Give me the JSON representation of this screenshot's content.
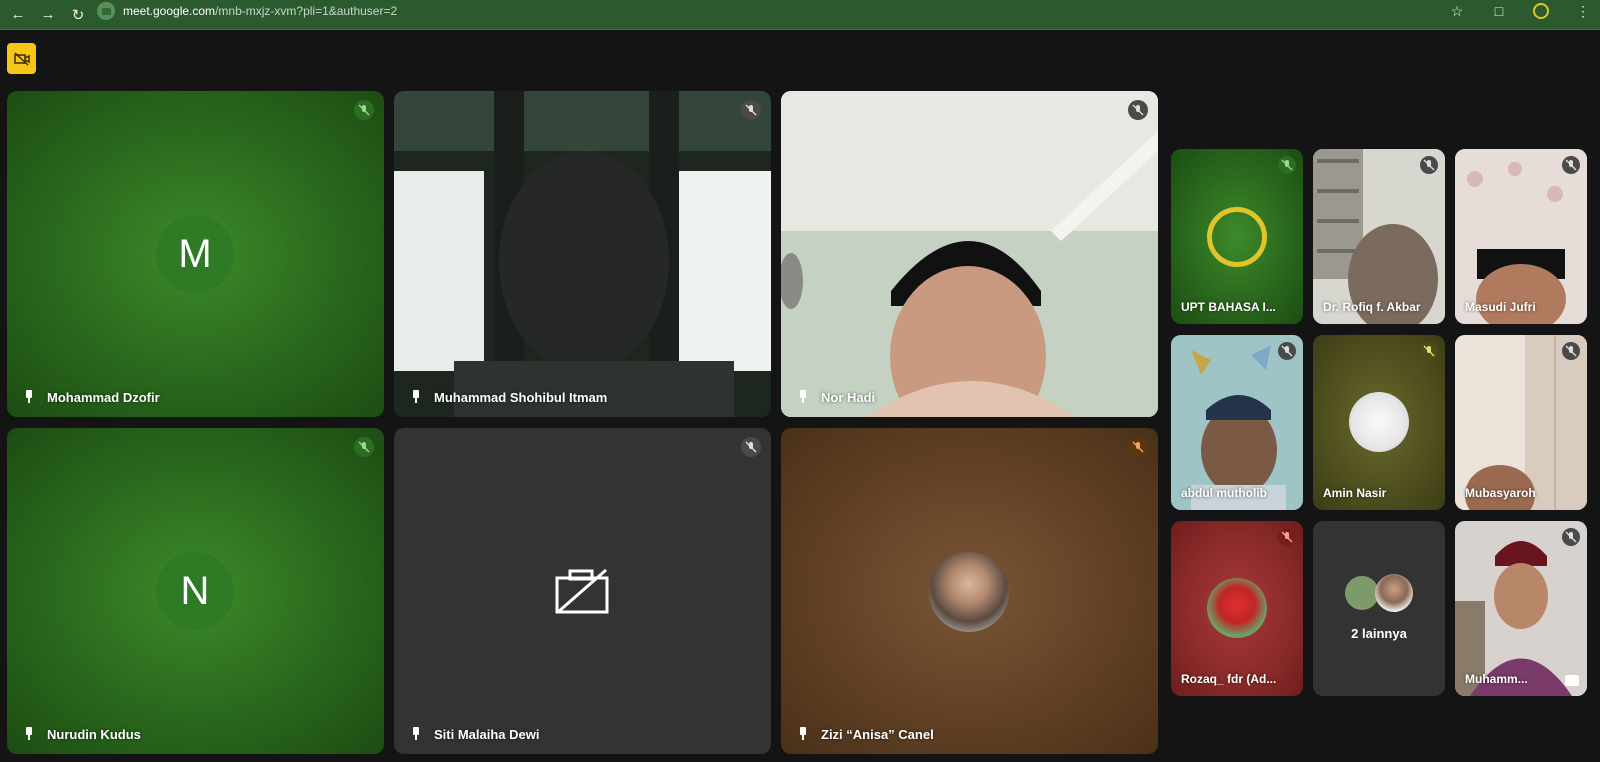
{
  "browser": {
    "url_host": "meet.google.com",
    "url_path": "/mnb-mxjz-xvm?pli=1&authuser=2"
  },
  "main_tiles": [
    {
      "name": "Mohammad Dzofir",
      "initial": "M"
    },
    {
      "name": "Muhammad Shohibul Itmam"
    },
    {
      "name": "Nor Hadi"
    },
    {
      "name": "Nurudin Kudus",
      "initial": "N"
    },
    {
      "name": "Siti Malaiha Dewi"
    },
    {
      "name": "Zizi “Anisa” Canel"
    }
  ],
  "side_tiles": [
    {
      "name": "UPT BAHASA I..."
    },
    {
      "name": "Dr. Rofiq f. Akbar"
    },
    {
      "name": "Masudi Jufri"
    },
    {
      "name": "abdul mutholib"
    },
    {
      "name": "Amin Nasir"
    },
    {
      "name": "Mubasyaroh"
    },
    {
      "name": "Rozaq_ fdr (Ad..."
    },
    {
      "name": "2 lainnya"
    },
    {
      "name": "Muhamm..."
    }
  ],
  "colors": {
    "browser_bar": "#2b5a2f",
    "background": "#141414",
    "recording_badge": "#f5c518",
    "tile_green": "#2d6e1f",
    "tile_dark": "#333333"
  }
}
